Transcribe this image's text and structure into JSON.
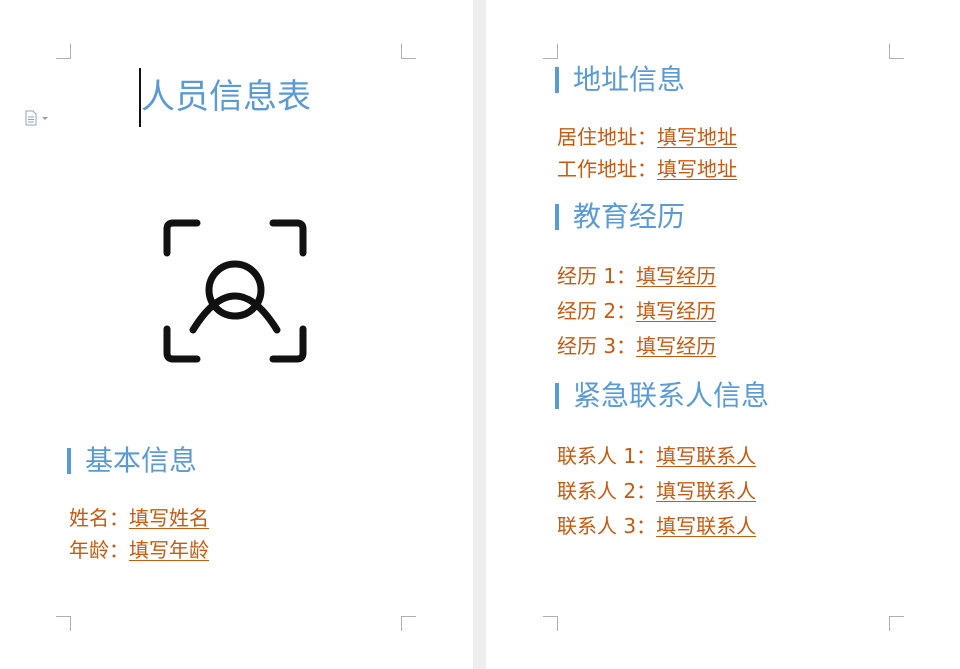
{
  "left_page": {
    "title": "人员信息表",
    "sections": {
      "basic_info": {
        "heading": "基本信息",
        "fields": [
          {
            "label": "姓名：",
            "value": "填写姓名"
          },
          {
            "label": "年龄：",
            "value": "填写年龄"
          }
        ]
      }
    }
  },
  "right_page": {
    "sections": {
      "address": {
        "heading": "地址信息",
        "fields": [
          {
            "label": "居住地址：",
            "value": "填写地址"
          },
          {
            "label": "工作地址：",
            "value": "填写地址"
          }
        ]
      },
      "education": {
        "heading": "教育经历",
        "fields": [
          {
            "label": "经历 1：",
            "value": "填写经历"
          },
          {
            "label": "经历 2：",
            "value": "填写经历"
          },
          {
            "label": "经历 3：",
            "value": "填写经历"
          }
        ]
      },
      "emergency": {
        "heading": "紧急联系人信息",
        "fields": [
          {
            "label": "联系人 1：",
            "value": "填写联系人"
          },
          {
            "label": "联系人 2：",
            "value": "填写联系人"
          },
          {
            "label": "联系人 3：",
            "value": "填写联系人"
          }
        ]
      }
    }
  },
  "icons": {
    "avatar": "face-scan-user-icon",
    "side_menu": "document-icon"
  },
  "colors": {
    "heading": "#5b9bd5",
    "field_text": "#c55a11",
    "page_background": "#ffffff",
    "canvas_background": "#eeeeee"
  }
}
